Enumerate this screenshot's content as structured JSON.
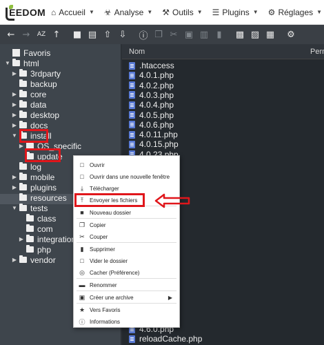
{
  "logo": {
    "text": "EEDOM"
  },
  "nav": [
    {
      "icon": "home-icon",
      "glyph": "⌂",
      "label": "Accueil"
    },
    {
      "icon": "analysis-icon",
      "glyph": "☣",
      "label": "Analyse"
    },
    {
      "icon": "tools-icon",
      "glyph": "⚒",
      "label": "Outils"
    },
    {
      "icon": "plugins-icon",
      "glyph": "☰",
      "label": "Plugins"
    },
    {
      "icon": "settings-icon",
      "glyph": "⚙",
      "label": "Réglages"
    }
  ],
  "toolbar": [
    {
      "icon": "back-icon",
      "glyph": "←"
    },
    {
      "icon": "forward-icon",
      "glyph": "→",
      "dim": true
    },
    {
      "icon": "sort-az-icon",
      "glyph": "AZ"
    },
    {
      "icon": "up-icon",
      "glyph": "↑"
    },
    {
      "icon": "new-folder-icon",
      "glyph": "■"
    },
    {
      "icon": "new-file-icon",
      "glyph": "▤"
    },
    {
      "icon": "upload-icon",
      "glyph": "⇧"
    },
    {
      "icon": "download-icon",
      "glyph": "⇩"
    },
    {
      "icon": "info-icon",
      "glyph": "ⓘ"
    },
    {
      "icon": "copy-icon",
      "glyph": "❐",
      "dim": true
    },
    {
      "icon": "cut-icon",
      "glyph": "✂",
      "dim": true
    },
    {
      "icon": "paste-icon",
      "glyph": "▣",
      "dim": true
    },
    {
      "icon": "duplicate-icon",
      "glyph": "▥",
      "dim": true
    },
    {
      "icon": "delete-icon",
      "glyph": "▮",
      "dim": true
    },
    {
      "icon": "archive-icon",
      "glyph": "▩"
    },
    {
      "icon": "extract-icon",
      "glyph": "▨"
    },
    {
      "icon": "view-icon",
      "glyph": "▦"
    },
    {
      "icon": "gear-icon",
      "glyph": "⚙"
    }
  ],
  "tree": [
    {
      "label": "Favoris",
      "level": 0,
      "arrow": "",
      "kind": "star"
    },
    {
      "label": "html",
      "level": 0,
      "arrow": "▼",
      "kind": "folder"
    },
    {
      "label": "3rdparty",
      "level": 1,
      "arrow": "▶",
      "kind": "folder"
    },
    {
      "label": "backup",
      "level": 1,
      "arrow": "",
      "kind": "folder"
    },
    {
      "label": "core",
      "level": 1,
      "arrow": "▶",
      "kind": "folder"
    },
    {
      "label": "data",
      "level": 1,
      "arrow": "▶",
      "kind": "folder"
    },
    {
      "label": "desktop",
      "level": 1,
      "arrow": "▶",
      "kind": "folder"
    },
    {
      "label": "docs",
      "level": 1,
      "arrow": "▶",
      "kind": "folder"
    },
    {
      "label": "install",
      "level": 1,
      "arrow": "▼",
      "kind": "folder"
    },
    {
      "label": "OS_specific",
      "level": 2,
      "arrow": "▶",
      "kind": "folder"
    },
    {
      "label": "update",
      "level": 2,
      "arrow": "",
      "kind": "folder"
    },
    {
      "label": "log",
      "level": 1,
      "arrow": "",
      "kind": "folder"
    },
    {
      "label": "mobile",
      "level": 1,
      "arrow": "▶",
      "kind": "folder"
    },
    {
      "label": "plugins",
      "level": 1,
      "arrow": "▶",
      "kind": "folder"
    },
    {
      "label": "resources",
      "level": 1,
      "arrow": "",
      "kind": "folder"
    },
    {
      "label": "tests",
      "level": 1,
      "arrow": "▼",
      "kind": "folder"
    },
    {
      "label": "class",
      "level": 2,
      "arrow": "",
      "kind": "folder"
    },
    {
      "label": "com",
      "level": 2,
      "arrow": "",
      "kind": "folder"
    },
    {
      "label": "integration",
      "level": 2,
      "arrow": "▶",
      "kind": "folder"
    },
    {
      "label": "php",
      "level": 2,
      "arrow": "",
      "kind": "folder"
    },
    {
      "label": "vendor",
      "level": 1,
      "arrow": "▶",
      "kind": "folder"
    }
  ],
  "files_header": {
    "name": "Nom",
    "perm": "Perm"
  },
  "files_top": [
    ".htaccess",
    "4.0.1.php",
    "4.0.2.php",
    "4.0.3.php",
    "4.0.4.php",
    "4.0.5.php",
    "4.0.6.php",
    "4.0.11.php",
    "4.0.15.php",
    "4.0.23.php"
  ],
  "files_bottom": [
    "4.6.0.php",
    "reloadCache.php"
  ],
  "context_menu": [
    {
      "icon": "folder-open-icon",
      "glyph": "□",
      "label": "Ouvrir"
    },
    {
      "icon": "new-window-icon",
      "glyph": "□",
      "label": "Ouvrir dans une nouvelle fenêtre"
    },
    {
      "icon": "download-icon",
      "glyph": "⤓",
      "label": "Télécharger"
    },
    {
      "icon": "upload-icon",
      "glyph": "⤒",
      "label": "Envoyer les fichiers"
    },
    {
      "icon": "new-folder-icon",
      "glyph": "■",
      "label": "Nouveau dossier"
    },
    {
      "icon": "copy-icon",
      "glyph": "❐",
      "label": "Copier"
    },
    {
      "icon": "cut-icon",
      "glyph": "✂",
      "label": "Couper"
    },
    {
      "icon": "trash-icon",
      "glyph": "▮",
      "label": "Supprimer"
    },
    {
      "icon": "empty-folder-icon",
      "glyph": "□",
      "label": "Vider le dossier"
    },
    {
      "icon": "hidden-icon",
      "glyph": "◎",
      "label": "Cacher (Préférence)"
    },
    {
      "icon": "rename-icon",
      "glyph": "▬",
      "label": "Renommer"
    },
    {
      "icon": "archive-icon",
      "glyph": "▣",
      "label": "Créer une archive"
    },
    {
      "icon": "favorites-icon",
      "glyph": "★",
      "label": "Vers Favoris"
    },
    {
      "icon": "info-icon",
      "glyph": "ⓘ",
      "label": "Informations"
    }
  ],
  "colors": {
    "annotation": "#e0161b",
    "file_icon": "#5a7bd6",
    "tree_bg": "#3e454c",
    "files_bg": "#24292e"
  }
}
